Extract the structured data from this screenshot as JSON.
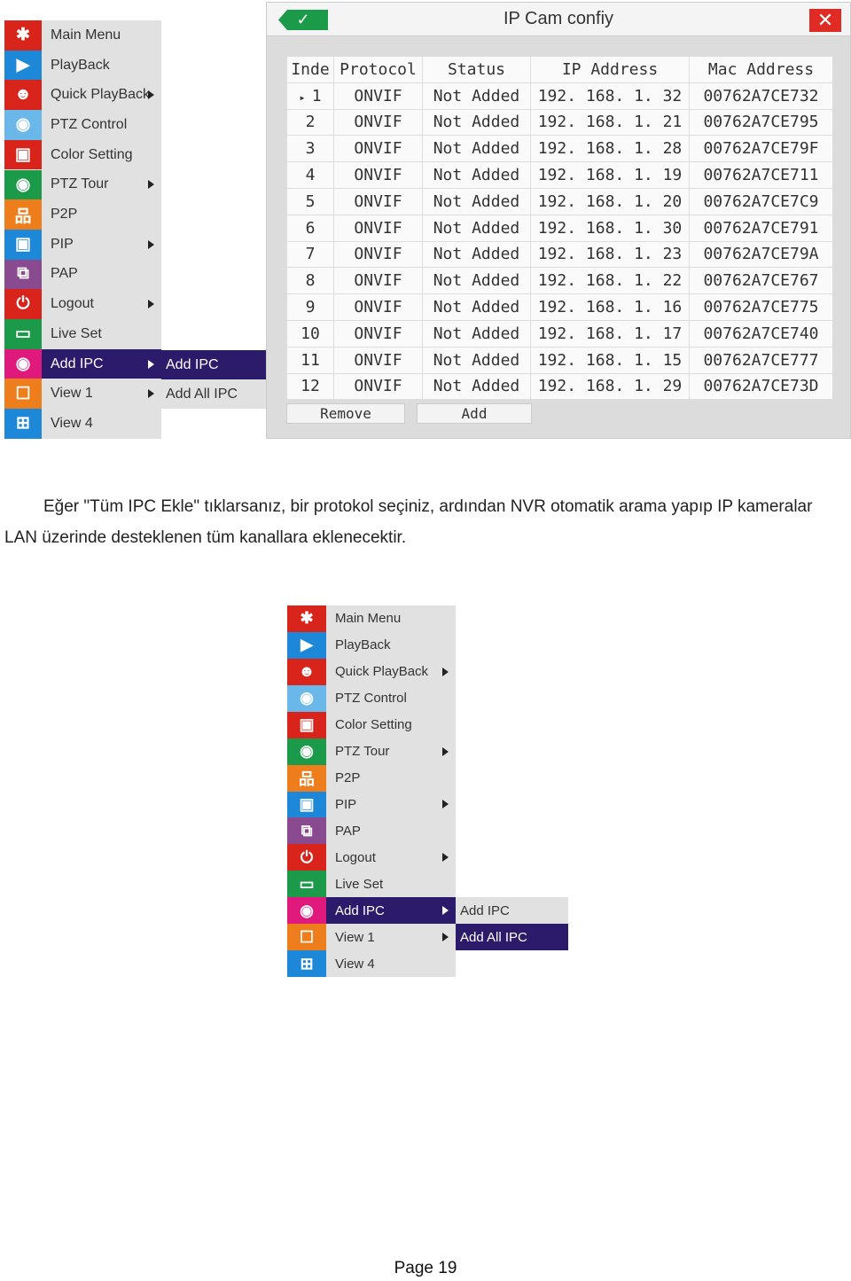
{
  "menu": {
    "items": [
      {
        "label": "Main Menu",
        "icon": "gear-icon",
        "glyph": "✱",
        "color": "#d9241c",
        "submenu": false
      },
      {
        "label": "PlayBack",
        "icon": "play-icon",
        "glyph": "▶",
        "color": "#1e88d8",
        "submenu": false
      },
      {
        "label": "Quick PlayBack",
        "icon": "person-playback-icon",
        "glyph": "☻",
        "color": "#d9241c",
        "submenu": true
      },
      {
        "label": "PTZ Control",
        "icon": "ptz-camera-icon",
        "glyph": "◉",
        "color": "#6ab8ea",
        "submenu": false
      },
      {
        "label": "Color Setting",
        "icon": "monitor-chart-icon",
        "glyph": "▣",
        "color": "#d9241c",
        "submenu": false
      },
      {
        "label": "PTZ Tour",
        "icon": "ptz-tour-icon",
        "glyph": "◉",
        "color": "#1b9a4a",
        "submenu": true
      },
      {
        "label": "P2P",
        "icon": "network-icon",
        "glyph": "品",
        "color": "#ee7d1b",
        "submenu": false
      },
      {
        "label": "PIP",
        "icon": "pip-icon",
        "glyph": "▣",
        "color": "#1e88d8",
        "submenu": true
      },
      {
        "label": "PAP",
        "icon": "pap-icon",
        "glyph": "⧉",
        "color": "#8a4a8f",
        "submenu": false
      },
      {
        "label": "Logout",
        "icon": "power-icon",
        "glyph": "⏻",
        "color": "#d9241c",
        "submenu": true
      },
      {
        "label": "Live Set",
        "icon": "live-set-icon",
        "glyph": "▭",
        "color": "#1b9a4a",
        "submenu": false
      },
      {
        "label": "Add IPC",
        "icon": "add-ipc-camera-icon",
        "glyph": "◉",
        "color": "#e0197d",
        "submenu": true
      },
      {
        "label": "View 1",
        "icon": "view1-icon",
        "glyph": "☐",
        "color": "#ee7d1b",
        "submenu": true
      },
      {
        "label": "View 4",
        "icon": "view4-icon",
        "glyph": "⊞",
        "color": "#1e88d8",
        "submenu": false
      }
    ],
    "selected": "Add IPC",
    "submenu": [
      "Add IPC",
      "Add All IPC"
    ],
    "submenu_selected_top": "Add IPC",
    "submenu_selected_bottom": "Add All IPC"
  },
  "dialog": {
    "title": "IP Cam confiy",
    "ok_icon": "check-icon",
    "close_icon": "close-icon",
    "columns": [
      "Inde",
      "Protocol",
      "Status",
      "IP Address",
      "Mac Address"
    ],
    "rows": [
      [
        "1",
        "ONVIF",
        "Not Added",
        "192. 168. 1. 32",
        "00762A7CE732"
      ],
      [
        "2",
        "ONVIF",
        "Not Added",
        "192. 168. 1. 21",
        "00762A7CE795"
      ],
      [
        "3",
        "ONVIF",
        "Not Added",
        "192. 168. 1. 28",
        "00762A7CE79F"
      ],
      [
        "4",
        "ONVIF",
        "Not Added",
        "192. 168. 1. 19",
        "00762A7CE711"
      ],
      [
        "5",
        "ONVIF",
        "Not Added",
        "192. 168. 1. 20",
        "00762A7CE7C9"
      ],
      [
        "6",
        "ONVIF",
        "Not Added",
        "192. 168. 1. 30",
        "00762A7CE791"
      ],
      [
        "7",
        "ONVIF",
        "Not Added",
        "192. 168. 1. 23",
        "00762A7CE79A"
      ],
      [
        "8",
        "ONVIF",
        "Not Added",
        "192. 168. 1. 22",
        "00762A7CE767"
      ],
      [
        "9",
        "ONVIF",
        "Not Added",
        "192. 168. 1. 16",
        "00762A7CE775"
      ],
      [
        "10",
        "ONVIF",
        "Not Added",
        "192. 168. 1. 17",
        "00762A7CE740"
      ],
      [
        "11",
        "ONVIF",
        "Not Added",
        "192. 168. 1. 15",
        "00762A7CE777"
      ],
      [
        "12",
        "ONVIF",
        "Not Added",
        "192. 168. 1. 29",
        "00762A7CE73D"
      ]
    ],
    "remove_label": "Remove",
    "add_label": "Add"
  },
  "paragraph": "Eğer \"Tüm IPC Ekle\" tıklarsanız, bir protokol seçiniz, ardından NVR otomatik arama yapıp IP kameralar LAN üzerinde desteklenen tüm kanallara eklenecektir.",
  "page_number": "Page 19"
}
